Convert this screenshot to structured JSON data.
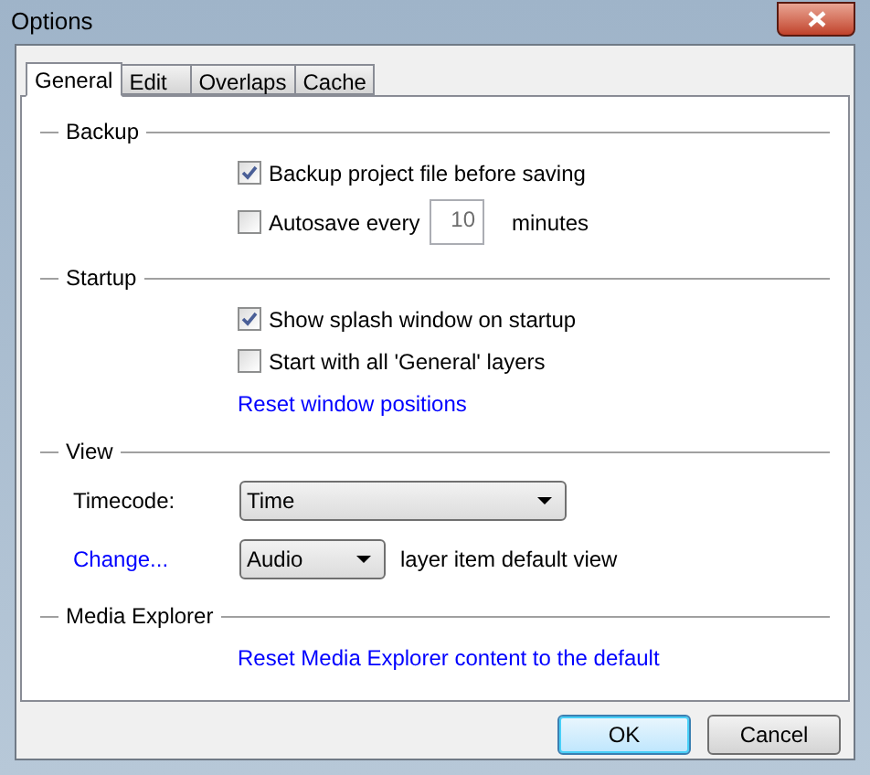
{
  "window": {
    "title": "Options"
  },
  "tabs": [
    {
      "label": "General",
      "selected": true
    },
    {
      "label": "Edit",
      "selected": false
    },
    {
      "label": "Overlaps",
      "selected": false
    },
    {
      "label": "Cache",
      "selected": false
    }
  ],
  "sections": [
    {
      "title": "Backup",
      "items": [
        {
          "kind": "checkbox",
          "label": "Backup project file before saving",
          "checked": true
        },
        {
          "kind": "checkbox_number",
          "label": "Autosave every",
          "checked": false,
          "value": "10",
          "suffix": "minutes"
        }
      ]
    },
    {
      "title": "Startup",
      "items": [
        {
          "kind": "checkbox",
          "label": "Show splash window on startup",
          "checked": true
        },
        {
          "kind": "checkbox",
          "label": "Start with all 'General' layers",
          "checked": false
        },
        {
          "kind": "link",
          "label": "Reset window positions"
        }
      ]
    },
    {
      "title": "View",
      "items": [
        {
          "kind": "dropdown",
          "label": "Timecode:",
          "value": "Time"
        },
        {
          "kind": "link_dropdown",
          "link": "Change...",
          "value": "Audio",
          "suffix": "layer item default view"
        }
      ]
    },
    {
      "title": "Media Explorer",
      "items": [
        {
          "kind": "link",
          "label": "Reset Media Explorer content to the default"
        }
      ]
    }
  ],
  "buttons": [
    {
      "label": "OK",
      "default": true
    },
    {
      "label": "Cancel",
      "default": false
    }
  ]
}
